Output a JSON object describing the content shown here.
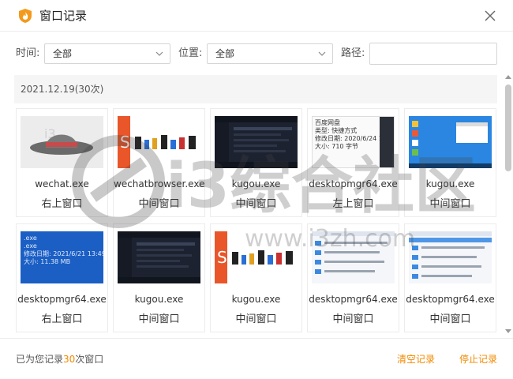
{
  "window": {
    "title": "窗口记录",
    "accent": "#f08a00"
  },
  "filters": {
    "time_label": "时间:",
    "time_value": "全部",
    "position_label": "位置:",
    "position_value": "全部",
    "path_label": "路径:",
    "path_value": "",
    "path_placeholder": ""
  },
  "group": {
    "date_label": "2021.12.19(30次)"
  },
  "records": [
    {
      "exe": "wechat.exe",
      "position": "右上窗口",
      "thumb": "wechat-hat"
    },
    {
      "exe": "wechatbrowser.exe",
      "position": "中间窗口",
      "thumb": "logo-banner"
    },
    {
      "exe": "kugou.exe",
      "position": "中间窗口",
      "thumb": "dark-app"
    },
    {
      "exe": "desktopmgr64.exe",
      "position": "左上窗口",
      "thumb": "file-info",
      "thumb_text": [
        "百度网盘",
        "类型: 快捷方式",
        "修改日期: 2020/6/24 1",
        "大小: 710 字节"
      ]
    },
    {
      "exe": "kugou.exe",
      "position": "中间窗口",
      "thumb": "desktop-blue"
    },
    {
      "exe": "desktopmgr64.exe",
      "position": "右上窗口",
      "thumb": "blue-file-info",
      "thumb_text": [
        ".exe",
        ".exe",
        "修改日期: 2021/6/21 13:49",
        "大小: 11.38 MB"
      ]
    },
    {
      "exe": "kugou.exe",
      "position": "中间窗口",
      "thumb": "dark-app"
    },
    {
      "exe": "kugou.exe",
      "position": "中间窗口",
      "thumb": "logo-banner"
    },
    {
      "exe": "desktopmgr64.exe",
      "position": "中间窗口",
      "thumb": "list-window"
    },
    {
      "exe": "desktopmgr64.exe",
      "position": "中间窗口",
      "thumb": "list-window-blue"
    }
  ],
  "footer": {
    "status_prefix": "已为您记录",
    "status_count": "30",
    "status_suffix": "次窗口",
    "clear_label": "清空记录",
    "stop_label": "停止记录"
  },
  "watermark": {
    "text_big": "i3综合社区",
    "text_url": "www.i3zh.com"
  }
}
